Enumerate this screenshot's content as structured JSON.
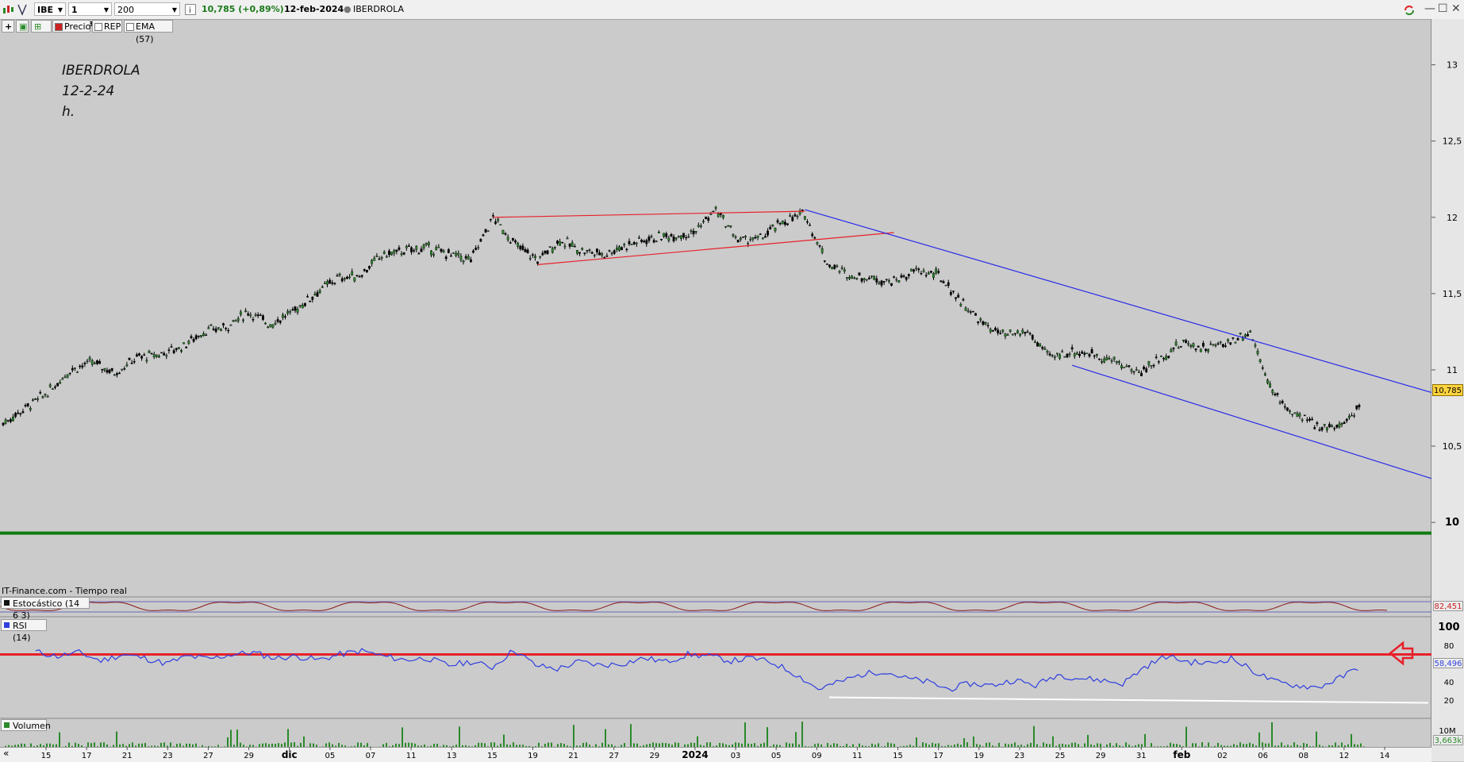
{
  "toolbar": {
    "symbol": "IBE",
    "interval": "1 hora",
    "units": "200 unidades",
    "quote": "10,785 (+0,89%)",
    "date": "12-feb-2024",
    "name": "IBERDROLA"
  },
  "legend": {
    "price": "Precio",
    "rep": "REP",
    "ema": "EMA (57)"
  },
  "annotation": {
    "line1": "IBERDROLA",
    "line2": "12-2-24",
    "line3": "h."
  },
  "source_label": "IT-Finance.com - Tiempo real",
  "panes": {
    "stoch_label": "Estocástico (14 6 3)",
    "stoch_value": "82,451",
    "rsi_label": "RSI (14)",
    "rsi_value": "58,496",
    "volume_label": "Volumen",
    "volume_value": "3,663k"
  },
  "colors": {
    "price_up": "#2a8a2a",
    "price_down": "#000000",
    "channel_red": "#e8202a",
    "channel_blue": "#2a2ae8",
    "support_green": "#117a11",
    "rsi_line": "#2f3fe0",
    "rsi_level_red": "#e8202a",
    "stoch_line": "#8b1a1a",
    "volume_bar": "#2a8a2a",
    "last_price_tag": "#ffd33d"
  },
  "chart_data": {
    "type": "line",
    "title": "",
    "price": {
      "last": "10,785",
      "yaxis_ticks": [
        "13",
        "12,5",
        "12",
        "11,5",
        "11",
        "10,5",
        "10"
      ],
      "ylim": [
        9.6,
        13.3
      ],
      "horizontal_line": 9.93,
      "series": [
        {
          "x": "14-nov",
          "y": 10.65
        },
        {
          "x": "15-nov",
          "y": 10.75
        },
        {
          "x": "16-nov",
          "y": 10.85
        },
        {
          "x": "17-nov",
          "y": 11.0
        },
        {
          "x": "20-nov",
          "y": 11.05
        },
        {
          "x": "21-nov",
          "y": 10.98
        },
        {
          "x": "22-nov",
          "y": 11.08
        },
        {
          "x": "23-nov",
          "y": 11.1
        },
        {
          "x": "24-nov",
          "y": 11.15
        },
        {
          "x": "27-nov",
          "y": 11.25
        },
        {
          "x": "28-nov",
          "y": 11.28
        },
        {
          "x": "29-nov",
          "y": 11.38
        },
        {
          "x": "30-nov",
          "y": 11.3
        },
        {
          "x": "01-dic",
          "y": 11.38
        },
        {
          "x": "04-dic",
          "y": 11.5
        },
        {
          "x": "05-dic",
          "y": 11.6
        },
        {
          "x": "06-dic",
          "y": 11.62
        },
        {
          "x": "07-dic",
          "y": 11.75
        },
        {
          "x": "08-dic",
          "y": 11.78
        },
        {
          "x": "11-dic",
          "y": 11.8
        },
        {
          "x": "12-dic",
          "y": 11.76
        },
        {
          "x": "13-dic",
          "y": 11.72
        },
        {
          "x": "14-dic",
          "y": 12.0
        },
        {
          "x": "15-dic",
          "y": 11.82
        },
        {
          "x": "18-dic",
          "y": 11.72
        },
        {
          "x": "19-dic",
          "y": 11.85
        },
        {
          "x": "20-dic",
          "y": 11.78
        },
        {
          "x": "21-dic",
          "y": 11.76
        },
        {
          "x": "22-dic",
          "y": 11.82
        },
        {
          "x": "27-dic",
          "y": 11.86
        },
        {
          "x": "28-dic",
          "y": 11.88
        },
        {
          "x": "29-dic",
          "y": 11.9
        },
        {
          "x": "02-ene",
          "y": 12.05
        },
        {
          "x": "03-ene",
          "y": 11.85
        },
        {
          "x": "04-ene",
          "y": 11.86
        },
        {
          "x": "05-ene",
          "y": 11.97
        },
        {
          "x": "08-ene",
          "y": 12.02
        },
        {
          "x": "09-ene",
          "y": 11.7
        },
        {
          "x": "10-ene",
          "y": 11.62
        },
        {
          "x": "11-ene",
          "y": 11.6
        },
        {
          "x": "12-ene",
          "y": 11.58
        },
        {
          "x": "15-ene",
          "y": 11.65
        },
        {
          "x": "16-ene",
          "y": 11.62
        },
        {
          "x": "17-ene",
          "y": 11.45
        },
        {
          "x": "18-ene",
          "y": 11.3
        },
        {
          "x": "19-ene",
          "y": 11.22
        },
        {
          "x": "22-ene",
          "y": 11.25
        },
        {
          "x": "23-ene",
          "y": 11.08
        },
        {
          "x": "24-ene",
          "y": 11.12
        },
        {
          "x": "25-ene",
          "y": 11.1
        },
        {
          "x": "26-ene",
          "y": 11.05
        },
        {
          "x": "29-ene",
          "y": 10.98
        },
        {
          "x": "30-ene",
          "y": 11.08
        },
        {
          "x": "31-ene",
          "y": 11.18
        },
        {
          "x": "01-feb",
          "y": 11.14
        },
        {
          "x": "02-feb",
          "y": 11.18
        },
        {
          "x": "05-feb",
          "y": 11.25
        },
        {
          "x": "06-feb",
          "y": 10.85
        },
        {
          "x": "07-feb",
          "y": 10.7
        },
        {
          "x": "08-feb",
          "y": 10.64
        },
        {
          "x": "09-feb",
          "y": 10.62
        },
        {
          "x": "12-feb",
          "y": 10.785
        }
      ],
      "channels": [
        {
          "name": "red-upper",
          "from": {
            "x": "14-dic",
            "y": 12.0
          },
          "to": {
            "x": "08-ene",
            "y": 12.04
          }
        },
        {
          "name": "red-lower",
          "from": {
            "x": "18-dic",
            "y": 11.69
          },
          "to": {
            "x": "12-ene",
            "y": 11.9
          }
        },
        {
          "name": "blue-upper",
          "from": {
            "x": "08-ene",
            "y": 12.05
          },
          "to": {
            "x": "14-feb",
            "y": 10.9
          }
        },
        {
          "name": "blue-lower",
          "from": {
            "x": "24-ene",
            "y": 11.03
          },
          "to": {
            "x": "14-feb",
            "y": 10.34
          }
        }
      ]
    },
    "rsi": {
      "yaxis_ticks": [
        "100",
        "80",
        "60",
        "40",
        "20"
      ],
      "ylim": [
        0,
        100
      ],
      "level": 70,
      "values": [
        73,
        68,
        72,
        63,
        70,
        66,
        60,
        68,
        65,
        70,
        72,
        66,
        68,
        64,
        70,
        74,
        68,
        64,
        66,
        58,
        62,
        56,
        75,
        58,
        54,
        62,
        58,
        60,
        66,
        62,
        70,
        68,
        63,
        66,
        60,
        48,
        32,
        40,
        48,
        52,
        44,
        40,
        32,
        38,
        36,
        42,
        36,
        48,
        44,
        42,
        38,
        56,
        68,
        62,
        60,
        66,
        52,
        40,
        36,
        34,
        44,
        58
      ]
    },
    "stochastic": {
      "label": "Estocástico (14 6 3)",
      "last": 82.451
    },
    "volume": {
      "yaxis_ticks": [
        "10M"
      ],
      "last": "3,663k"
    },
    "xaxis_labels": [
      "15",
      "17",
      "21",
      "23",
      "27",
      "29",
      "dic",
      "05",
      "07",
      "11",
      "13",
      "15",
      "19",
      "21",
      "27",
      "29",
      "2024",
      "03",
      "05",
      "09",
      "11",
      "15",
      "17",
      "19",
      "23",
      "25",
      "29",
      "31",
      "feb",
      "02",
      "06",
      "08",
      "12",
      "14"
    ]
  }
}
